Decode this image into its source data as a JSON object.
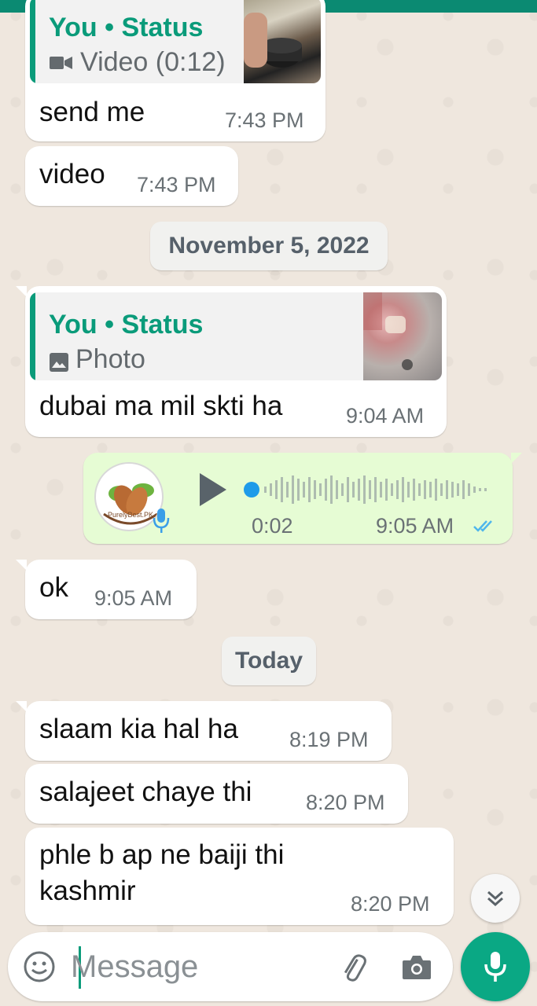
{
  "colors": {
    "accent": "#0a9b7a",
    "incoming_bubble": "#ffffff",
    "outgoing_bubble": "#e6fcd4",
    "read_ticks": "#4fb6ec",
    "fab": "#0aa884"
  },
  "messages": [
    {
      "direction": "in",
      "quote": {
        "author": "You • Status",
        "kind_icon": "video-camera-icon",
        "kind": "Video (0:12)"
      },
      "text": "send me",
      "time": "7:43 PM"
    },
    {
      "direction": "in",
      "text": "video",
      "time": "7:43 PM"
    },
    {
      "type": "date",
      "label": "November 5, 2022"
    },
    {
      "direction": "in",
      "quote": {
        "author": "You • Status",
        "kind_icon": "photo-icon",
        "kind": "Photo"
      },
      "text": "dubai ma mil skti ha",
      "time": "9:04 AM"
    },
    {
      "direction": "out",
      "type": "voice",
      "avatar_text": "PurelyBest.PK",
      "duration": "0:02",
      "time": "9:05 AM",
      "status": "read"
    },
    {
      "direction": "in",
      "text": "ok",
      "time": "9:05 AM"
    },
    {
      "type": "date",
      "label": "Today"
    },
    {
      "direction": "in",
      "text": "slaam kia hal ha",
      "time": "8:19 PM"
    },
    {
      "direction": "in",
      "text": "salajeet chaye thi",
      "time": "8:20 PM"
    },
    {
      "direction": "in",
      "text": "phle b ap ne baiji thi\nkashmir",
      "time": "8:20 PM"
    }
  ],
  "composer": {
    "placeholder": "Message",
    "value": "",
    "emoji_icon": "emoji-icon",
    "attach_icon": "paperclip-icon",
    "camera_icon": "camera-icon",
    "send_icon": "microphone-icon"
  },
  "scroll_down_icon": "double-chevron-down-icon"
}
